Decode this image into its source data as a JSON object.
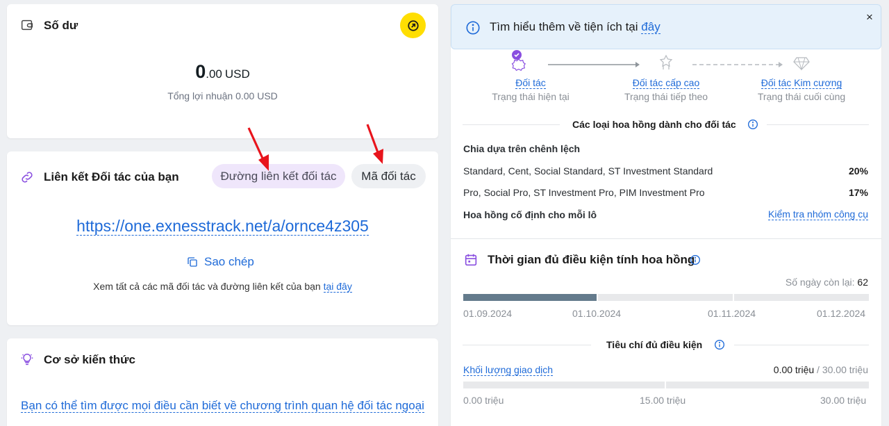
{
  "balance": {
    "title": "Số dư",
    "amount_int": "0",
    "amount_dec": ".00",
    "currency": "USD",
    "profit": "Tổng lợi nhuận 0.00 USD"
  },
  "partner_link": {
    "title": "Liên kết Đối tác của bạn",
    "tab_link": "Đường liên kết đối tác",
    "tab_code": "Mã đối tác",
    "url": "https://one.exnesstrack.net/a/ornce4z305",
    "copy_label": "Sao chép",
    "view_all_text": "Xem tất cả các mã đối tác và đường liên kết của bạn",
    "view_all_link": "tại đây"
  },
  "knowledge": {
    "title": "Cơ sở kiến thức",
    "text": "Bạn có thể tìm được mọi điều cần biết về chương trình quan hệ đối tác ngoại"
  },
  "info_banner": {
    "text": "Tìm hiểu thêm về tiện ích tại",
    "link": "đây",
    "close": "×"
  },
  "tiers": [
    {
      "name": "Đối tác",
      "status": "Trạng thái hiện tại"
    },
    {
      "name": "Đối tác cấp cao",
      "status": "Trạng thái tiếp theo"
    },
    {
      "name": "Đối tác Kim cương",
      "status": "Trạng thái cuối cùng"
    }
  ],
  "commission": {
    "title": "Các loại hoa hồng dành cho đối tác",
    "spread_title": "Chia dựa trên chênh lệch",
    "rows": [
      {
        "label": "Standard, Cent, Social Standard, ST Investment Standard",
        "value": "20%"
      },
      {
        "label": "Pro, Social Pro, ST Investment Pro, PIM Investment Pro",
        "value": "17%"
      }
    ],
    "fixed_title": "Hoa hồng cố định cho mỗi lô",
    "check_link": "Kiểm tra nhóm công cụ"
  },
  "period": {
    "title": "Thời gian đủ điều kiện tính hoa hồng",
    "days_left_label": "Số ngày còn lại:",
    "days_left_value": "62",
    "progress_fraction": 0.33,
    "dates": [
      "01.09.2024",
      "01.10.2024",
      "01.11.2024",
      "01.12.2024"
    ]
  },
  "criteria": {
    "title": "Tiêu chí đủ điều kiện",
    "volume_label": "Khối lượng giao dịch",
    "volume_current": "0.00 triệu",
    "volume_target": "30.00 triệu",
    "scale": [
      "0.00 triệu",
      "15.00 triệu",
      "30.00 triệu"
    ]
  },
  "colors": {
    "accent_yellow": "#ffde02",
    "link_blue": "#1e6ad8",
    "purple": "#8a4fe0",
    "progress_fill": "#647b8c"
  }
}
